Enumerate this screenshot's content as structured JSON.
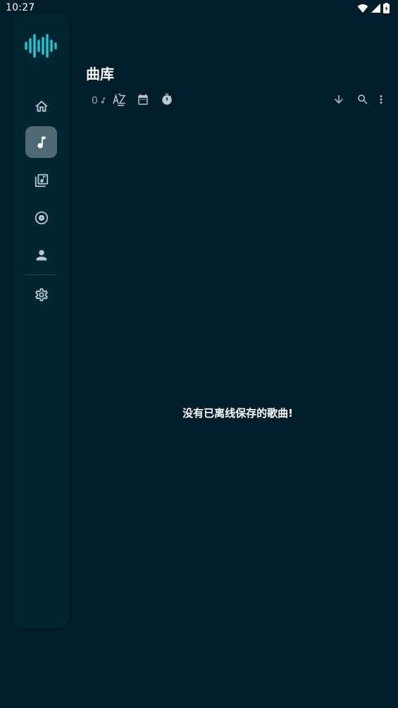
{
  "status_bar": {
    "time": "10:27",
    "icons": [
      "wifi-icon",
      "signal-icon",
      "battery-icon"
    ]
  },
  "nav_rail": {
    "logo": "waveform-logo",
    "items": [
      {
        "icon": "home-icon",
        "active": false
      },
      {
        "icon": "music-note-icon",
        "active": true
      },
      {
        "icon": "playlist-icon",
        "active": false
      },
      {
        "icon": "album-icon",
        "active": false
      },
      {
        "icon": "artist-icon",
        "active": false
      }
    ],
    "settings_icon": "gear-icon"
  },
  "header": {
    "title": "曲库"
  },
  "toolbar": {
    "song_count": "0",
    "sort_icons": [
      "sort-az-icon",
      "calendar-icon",
      "timer-icon"
    ],
    "action_icons": [
      "download-icon",
      "search-icon",
      "more-vert-icon"
    ]
  },
  "empty_state": {
    "message": "没有已离线保存的歌曲!"
  },
  "colors": {
    "background": "#001e2a",
    "rail": "#002634",
    "active_item": "#4f6a73",
    "accent": "#1ec8d2",
    "icon": "#b8c7cc",
    "muted": "#8ea2a9"
  }
}
